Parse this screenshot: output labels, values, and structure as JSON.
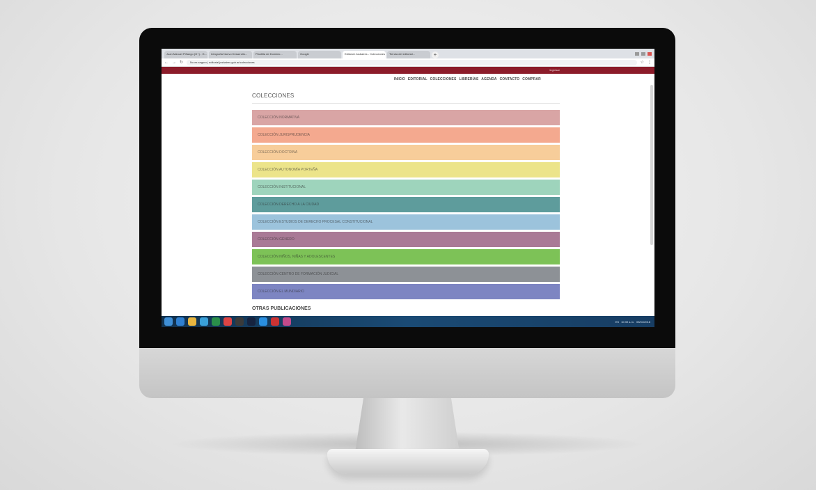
{
  "browser": {
    "tabs": [
      {
        "label": "Juan Manuel Piñango (G+) - G...",
        "active": false
      },
      {
        "label": "Infografía Nuevo Desarrollo...",
        "active": false
      },
      {
        "label": "Plantilla de Dominio...",
        "active": false
      },
      {
        "label": "Google",
        "active": false
      },
      {
        "label": "Editorial Jusbaires - Colecciones",
        "active": true
      },
      {
        "label": "Tienda del editorial...",
        "active": false
      }
    ],
    "new_tab": "+",
    "url": "editorial.jusbaires.gob.ar/colecciones",
    "url_security": "No es seguro"
  },
  "site": {
    "header_link": "Ingresar",
    "nav": [
      "INICIO",
      "EDITORIAL",
      "COLECCIONES",
      "LIBRERÍAS",
      "AGENDA",
      "CONTACTO",
      "COMPRAR"
    ],
    "page_title": "COLECCIONES",
    "collections": [
      {
        "label": "COLECCIÓN NORMATIVA",
        "color": "#d9a5a5"
      },
      {
        "label": "COLECCIÓN JURISPRUDENCIA",
        "color": "#f4a98f"
      },
      {
        "label": "COLECCIÓN DOCTRINA",
        "color": "#f7cd9a"
      },
      {
        "label": "COLECCIÓN AUTONOMÍA PORTEÑA",
        "color": "#ece48a"
      },
      {
        "label": "COLECCIÓN INSTITUCIONAL",
        "color": "#9ed4bc"
      },
      {
        "label": "COLECCIÓN DERECHO A LA CIUDAD",
        "color": "#5e9c9c"
      },
      {
        "label": "COLECCIÓN ESTUDIOS DE DERECHO PROCESAL CONSTITUCIONAL",
        "color": "#9cc3dc"
      },
      {
        "label": "COLECCIÓN GÉNERO",
        "color": "#a97a96"
      },
      {
        "label": "COLECCIÓN NIÑOS, NIÑAS Y ADOLESCENTES",
        "color": "#7dc257"
      },
      {
        "label": "COLECCIÓN CENTRO DE FORMACIÓN JUDICIAL",
        "color": "#8d9196"
      },
      {
        "label": "COLECCIÓN EL MUNDIARIO",
        "color": "#7d85c2"
      }
    ],
    "other_title": "OTRAS PUBLICACIONES"
  },
  "taskbar": {
    "icons": [
      "start-icon",
      "ie-icon",
      "explorer-icon",
      "media-icon",
      "excel-icon",
      "chrome-icon",
      "app-icon",
      "photoshop-icon",
      "app2-icon",
      "acrobat-icon",
      "indesign-icon"
    ],
    "tray": [
      "ES",
      "10:39 a.m.",
      "05/04/2018"
    ]
  }
}
